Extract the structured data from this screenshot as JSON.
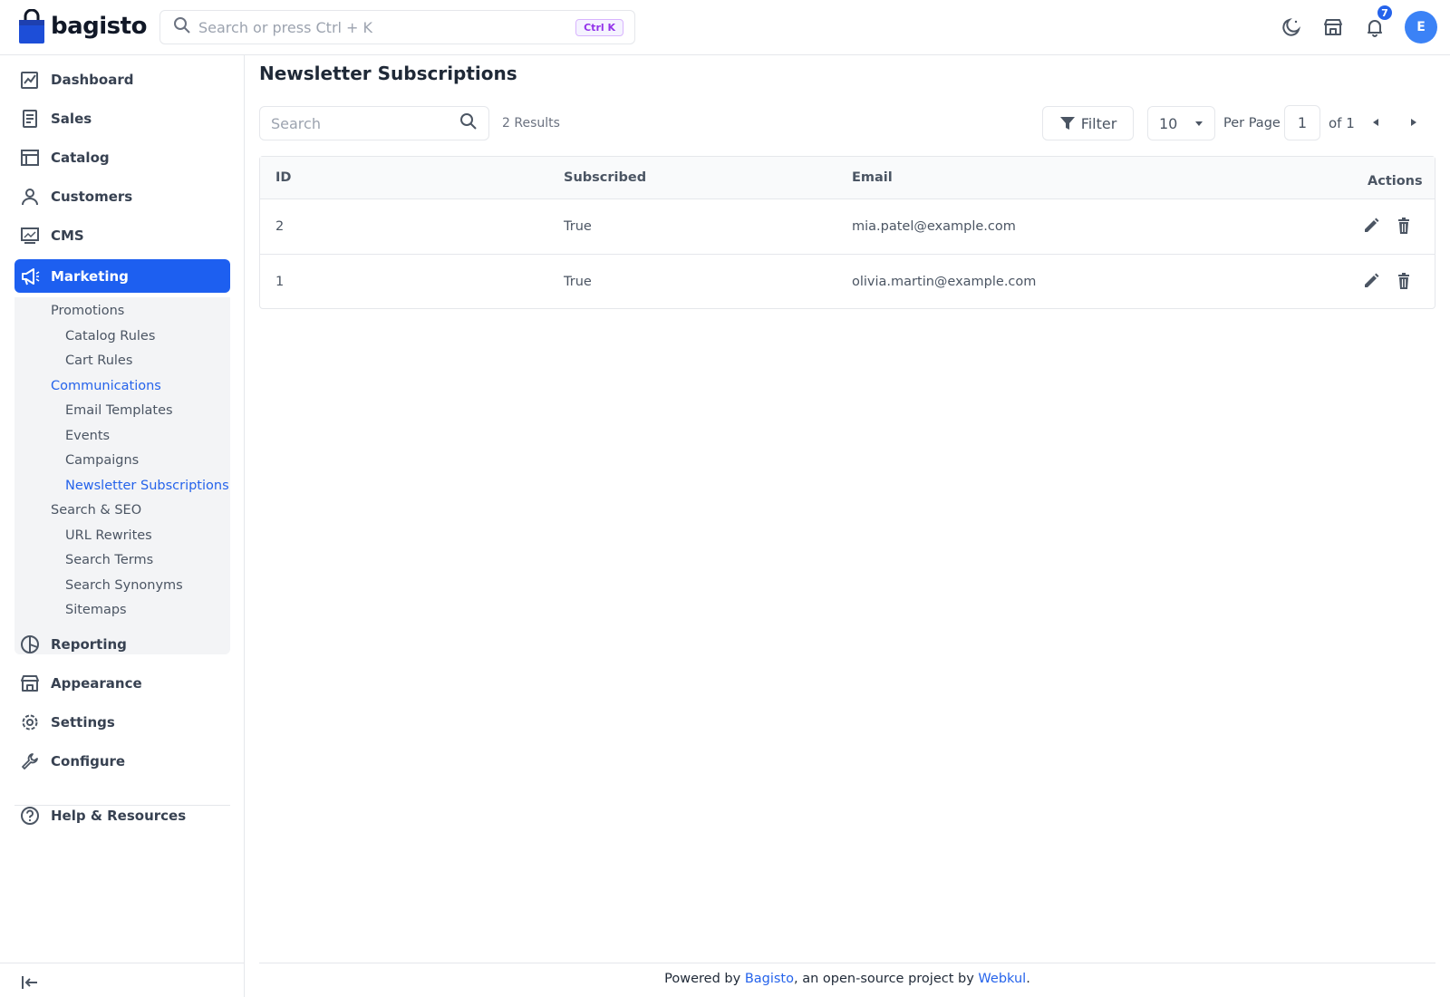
{
  "app": {
    "brand": "bagisto"
  },
  "header": {
    "search_placeholder": "Search or press Ctrl + K",
    "shortcut": "Ctrl K",
    "notification_count": "7",
    "avatar_initial": "E"
  },
  "sidebar": {
    "items": [
      {
        "label": "Dashboard",
        "icon": "dashboard-icon"
      },
      {
        "label": "Sales",
        "icon": "sales-icon"
      },
      {
        "label": "Catalog",
        "icon": "catalog-icon"
      },
      {
        "label": "Customers",
        "icon": "customers-icon"
      },
      {
        "label": "CMS",
        "icon": "cms-icon"
      },
      {
        "label": "Marketing",
        "icon": "marketing-icon",
        "active": true
      },
      {
        "label": "Reporting",
        "icon": "reporting-icon"
      },
      {
        "label": "Appearance",
        "icon": "appearance-icon"
      },
      {
        "label": "Settings",
        "icon": "settings-icon"
      },
      {
        "label": "Configure",
        "icon": "configure-icon"
      },
      {
        "label": "Help & Resources",
        "icon": "help-icon"
      }
    ],
    "submenu": [
      {
        "label": "Promotions",
        "level": 1
      },
      {
        "label": "Catalog Rules",
        "level": 2
      },
      {
        "label": "Cart Rules",
        "level": 2
      },
      {
        "label": "Communications",
        "level": 1,
        "active": true
      },
      {
        "label": "Email Templates",
        "level": 2
      },
      {
        "label": "Events",
        "level": 2
      },
      {
        "label": "Campaigns",
        "level": 2
      },
      {
        "label": "Newsletter Subscriptions",
        "level": 2,
        "active": true
      },
      {
        "label": "Search & SEO",
        "level": 1
      },
      {
        "label": "URL Rewrites",
        "level": 2
      },
      {
        "label": "Search Terms",
        "level": 2
      },
      {
        "label": "Search Synonyms",
        "level": 2
      },
      {
        "label": "Sitemaps",
        "level": 2
      }
    ]
  },
  "main": {
    "title": "Newsletter Subscriptions",
    "search_placeholder": "Search",
    "results": "2 Results",
    "filter_label": "Filter",
    "per_page_value": "10",
    "per_page_label": "Per Page",
    "page_current": "1",
    "page_total": "of 1",
    "table": {
      "columns": [
        "ID",
        "Subscribed",
        "Email",
        "Actions"
      ],
      "rows": [
        {
          "id": "2",
          "subscribed": "True",
          "email": "mia.patel@example.com"
        },
        {
          "id": "1",
          "subscribed": "True",
          "email": "olivia.martin@example.com"
        }
      ]
    }
  },
  "footer": {
    "prefix": "Powered by ",
    "link1": "Bagisto",
    "middle": ", an open-source project by ",
    "link2": "Webkul",
    "suffix": "."
  },
  "colors": {
    "accent": "#1d5ff0",
    "link": "#2563eb",
    "border": "#e5e7eb"
  }
}
